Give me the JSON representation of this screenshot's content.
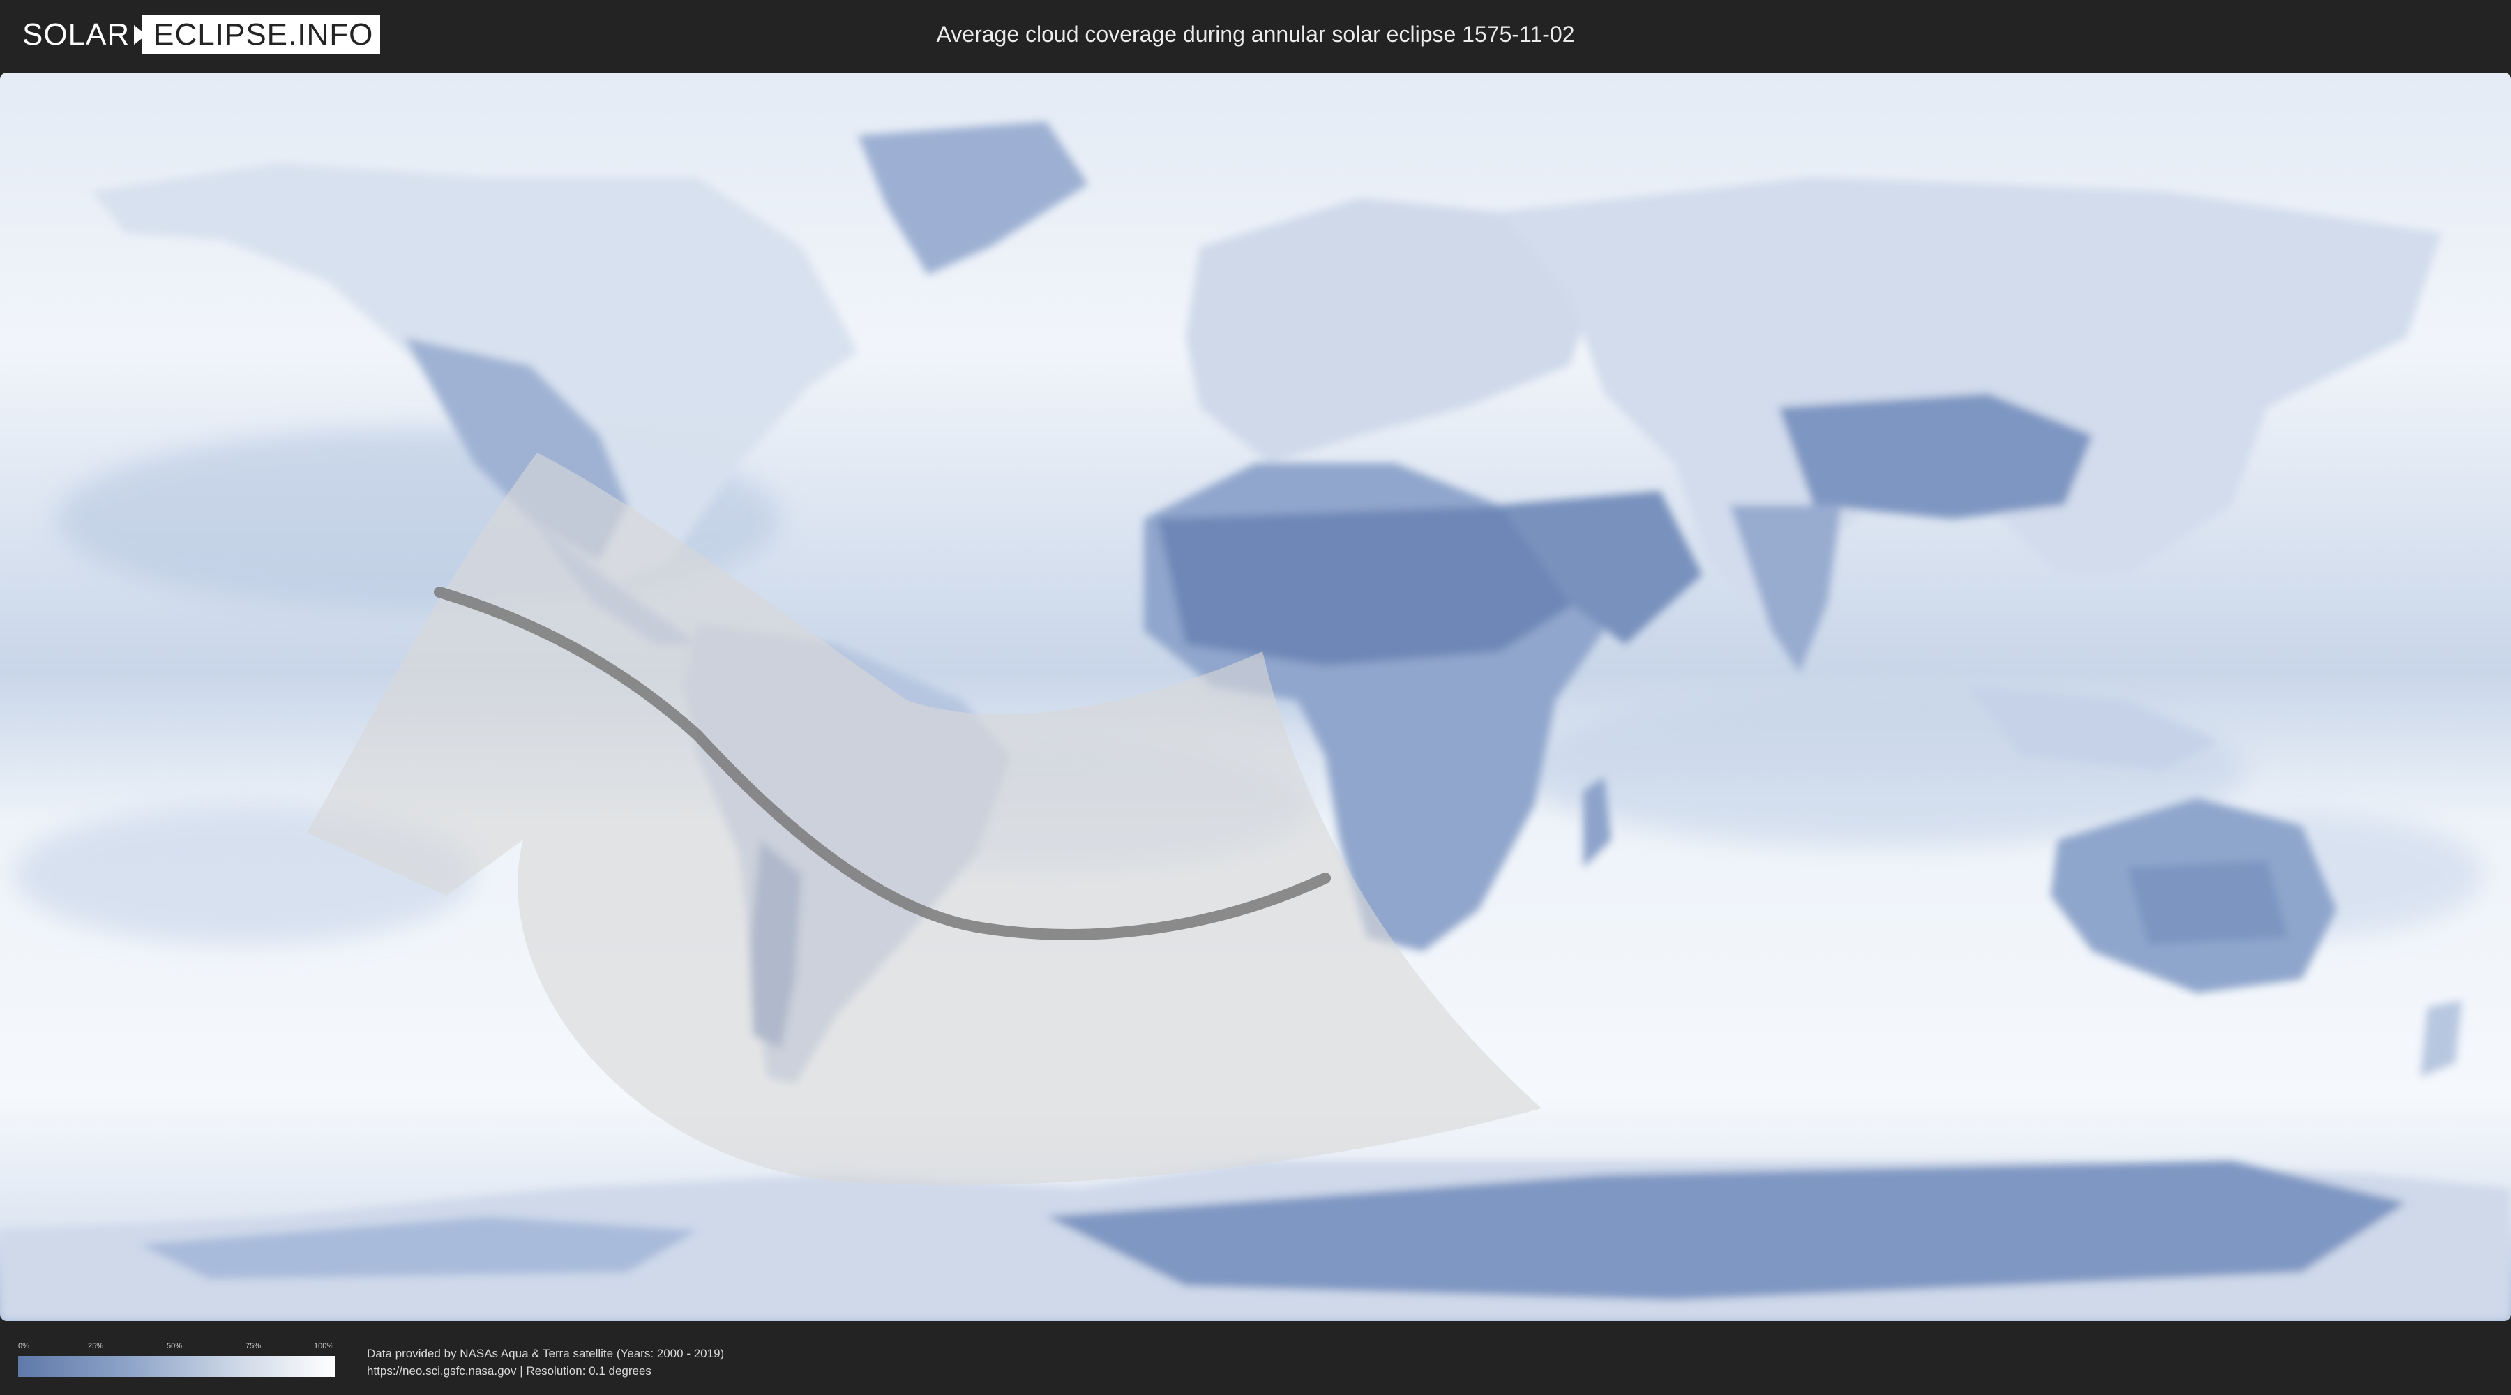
{
  "header": {
    "logo_part1": "SOLAR",
    "logo_part2": "ECLIPSE.INFO",
    "title": "Average cloud coverage during annular solar eclipse 1575-11-02"
  },
  "legend": {
    "ticks": [
      "0%",
      "25%",
      "50%",
      "75%",
      "100%"
    ],
    "colors": [
      "#5f79a9",
      "#8ea4c8",
      "#cfd9e8",
      "#ffffff"
    ]
  },
  "credits": {
    "line1": "Data provided by NASAs Aqua & Terra satellite (Years: 2000 - 2019)",
    "line2": "https://neo.sci.gsfc.nasa.gov | Resolution: 0.1 degrees"
  },
  "map": {
    "colors": {
      "ocean_cloud": "#e9eef6",
      "clear_sky": "#6f88b6",
      "land_clear": "#7a93bf",
      "eclipse_zone": "#d9d9d9",
      "central_line": "#777777"
    }
  }
}
